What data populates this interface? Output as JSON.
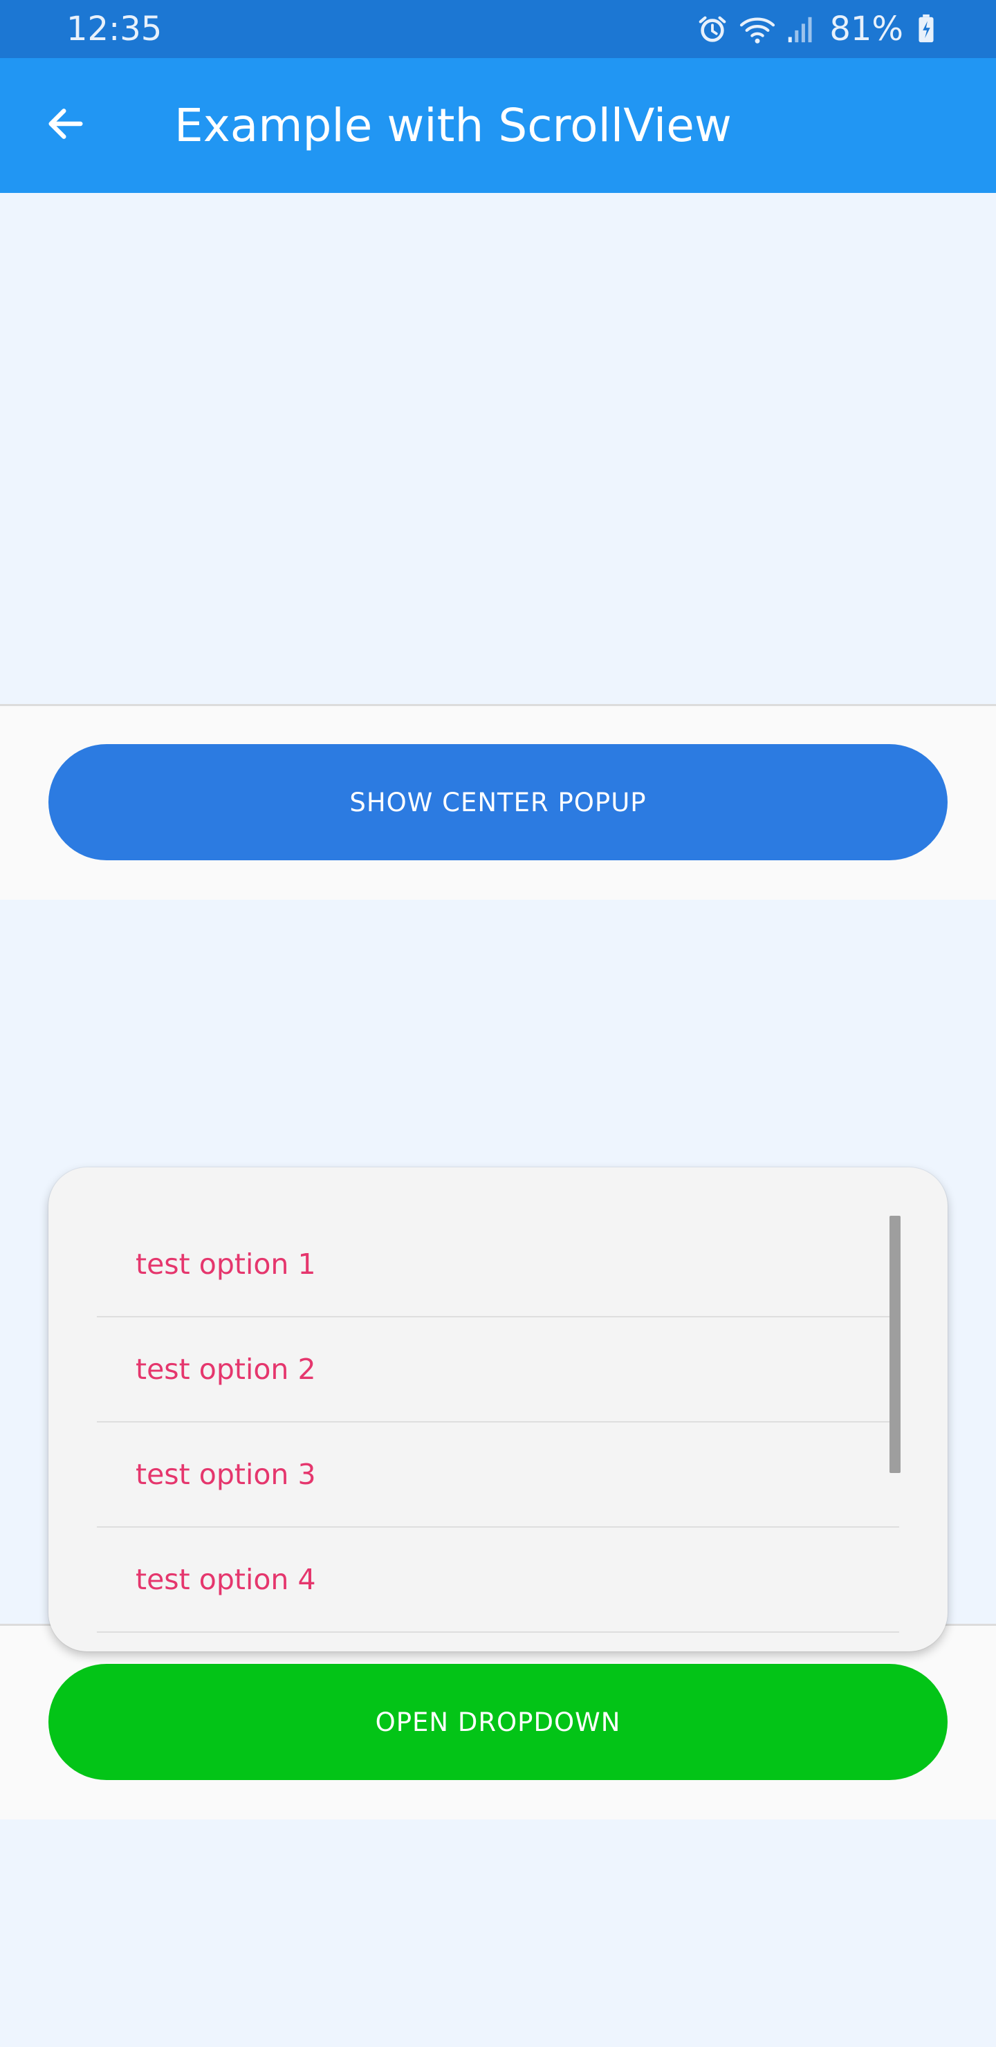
{
  "status_bar": {
    "time": "12:35",
    "battery": "81%",
    "icons": [
      "alarm-icon",
      "wifi-icon",
      "signal-icon",
      "battery-charging-icon"
    ]
  },
  "app_bar": {
    "title": "Example with ScrollView",
    "back_icon": "arrow-left-icon"
  },
  "buttons": {
    "center_popup": "SHOW CENTER POPUP",
    "open_dropdown": "OPEN DROPDOWN"
  },
  "dropdown": {
    "items": [
      "test option 1",
      "test option 2",
      "test option 3",
      "test option 4"
    ]
  },
  "colors": {
    "status_bar": "#1c77d3",
    "app_bar": "#2196f3",
    "center_button": "#2c7be1",
    "dropdown_button": "#03c417",
    "option_text": "#e5366d"
  }
}
